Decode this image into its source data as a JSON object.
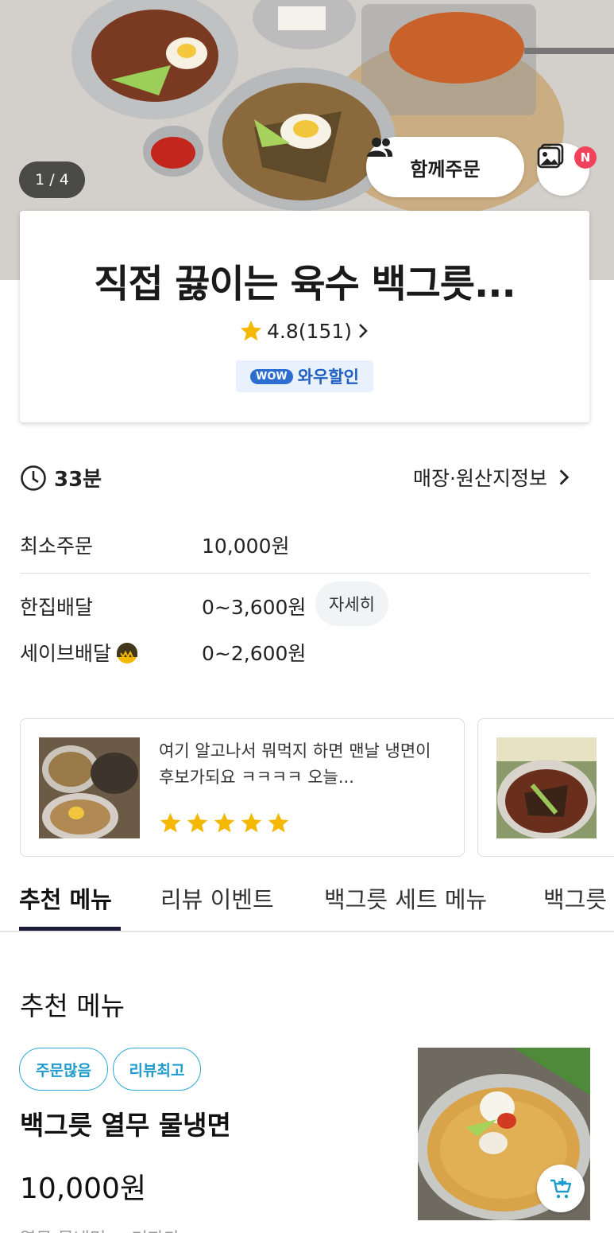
{
  "hero": {
    "counter": "1 / 4",
    "together_label": "함께주문",
    "new_badge": "N"
  },
  "store": {
    "name": "직접 끓이는 육수 백그릇...",
    "rating": "4.8(151)",
    "wow_pill": "WOW",
    "wow_label": "와우할인"
  },
  "info": {
    "time": "33분",
    "store_info_link": "매장·원산지정보",
    "min_order_label": "최소주문",
    "min_order_value": "10,000원",
    "delivery_label": "한집배달",
    "delivery_value": "0~3,600원",
    "detail_button": "자세히",
    "save_delivery_label": "세이브배달",
    "save_delivery_value": "0~2,600원"
  },
  "reviews": [
    {
      "text": "여기 알고나서 뭐먹지 하면 맨날 냉면이 후보가되요 ㅋㅋㅋㅋ 오늘...",
      "stars": 5
    }
  ],
  "tabs": [
    "추천 메뉴",
    "리뷰 이벤트",
    "백그릇 세트 메뉴",
    "백그릇"
  ],
  "section": {
    "title": "추천 메뉴"
  },
  "menu_item": {
    "tags": [
      "주문많음",
      "리뷰최고"
    ],
    "name": "백그릇 열무 물냉면",
    "price": "10,000원",
    "desc": "열무 물냉면 + 겨자가"
  },
  "colors": {
    "accent_blue": "#2b6ecf",
    "star": "#f5b800",
    "tag": "#2ea7d4",
    "badge_red": "#f0425a"
  }
}
